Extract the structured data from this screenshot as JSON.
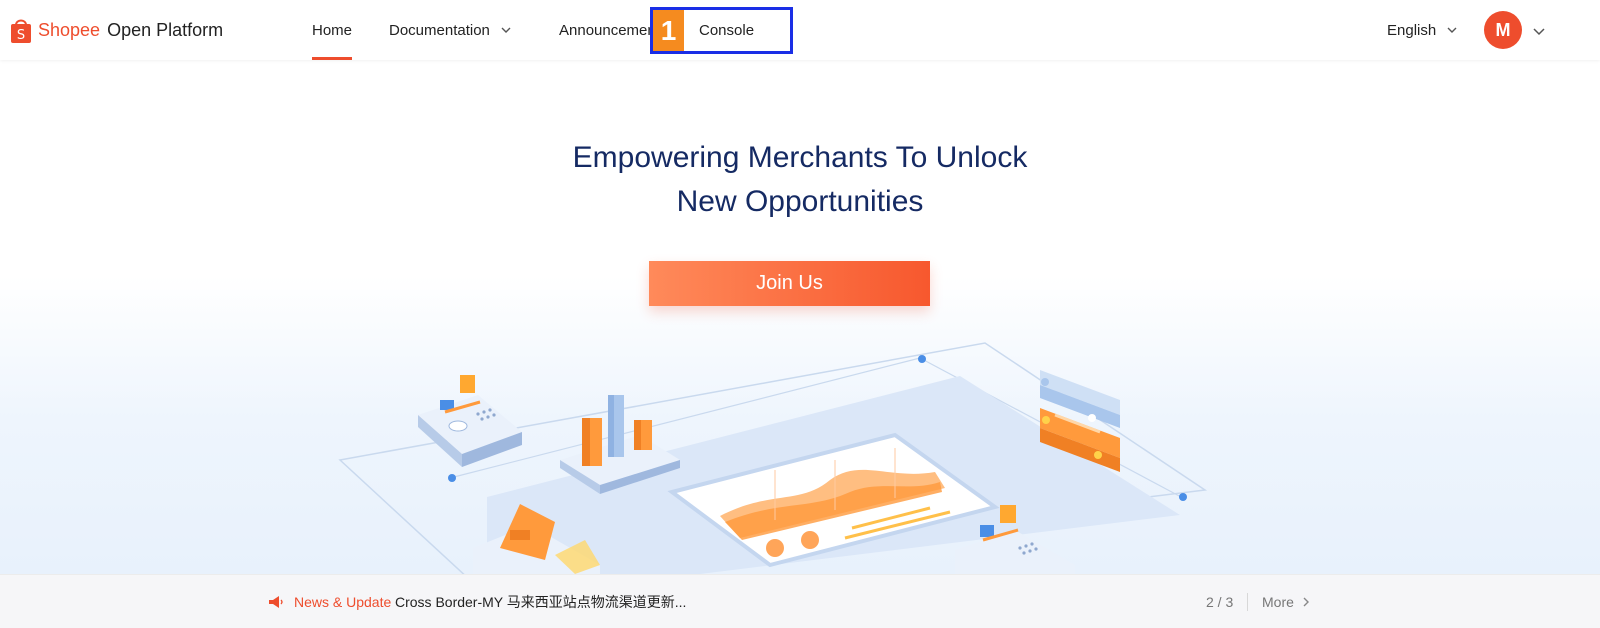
{
  "header": {
    "brand": "Shopee",
    "platform": "Open Platform",
    "nav": {
      "home": "Home",
      "documentation": "Documentation",
      "announcement": "Announcement",
      "console": "Console"
    },
    "language": "English",
    "avatar_initial": "M"
  },
  "annotation": {
    "number": "1"
  },
  "hero": {
    "title_line1": "Empowering Merchants To Unlock",
    "title_line2": "New Opportunities",
    "cta": "Join Us"
  },
  "news": {
    "label": "News & Update",
    "text": "Cross Border-MY 马来西亚站点物流渠道更新...",
    "page": "2 / 3",
    "more": "More"
  },
  "colors": {
    "brand": "#ee4d2d",
    "title": "#152a63",
    "accent_orange": "#f58b1f",
    "annotation_blue": "#1a2ee6",
    "chart_blue": "#a9c6ec"
  },
  "icons": [
    "shopee-bag-icon",
    "chevron-down-icon",
    "megaphone-icon",
    "chevron-right-icon"
  ]
}
